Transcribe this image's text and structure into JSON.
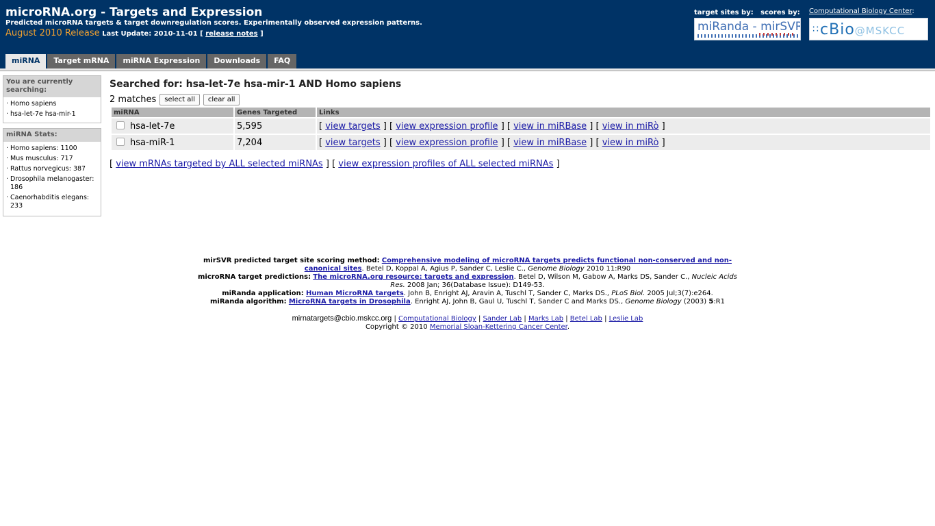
{
  "header": {
    "title": "microRNA.org - Targets and Expression",
    "tagline": "Predicted microRNA targets & target downregulation scores. Experimentally observed expression patterns.",
    "release": "August 2010 Release",
    "last_update_label": "Last Update:",
    "last_update": "2010-11-01",
    "release_notes_open": "[",
    "release_notes": "release notes",
    "release_notes_close": "]",
    "sites_label": "target sites by:   scores by:",
    "mirsvr_logo_text": "miRanda - mirSVR",
    "cbc_link": "Computational Biology Center",
    "cbc_colon": ":",
    "cbio_logo": {
      "dots": "∷",
      "main": "cBio",
      "suffix": "@MSKCC"
    }
  },
  "tabs": [
    {
      "label": "miRNA",
      "active": true
    },
    {
      "label": "Target mRNA",
      "active": false
    },
    {
      "label": "miRNA Expression",
      "active": false
    },
    {
      "label": "Downloads",
      "active": false
    },
    {
      "label": "FAQ",
      "active": false
    }
  ],
  "sidebar": {
    "searching_title": "You are currently searching:",
    "searching_items": [
      "Homo sapiens",
      "hsa-let-7e hsa-mir-1"
    ],
    "stats_title": "miRNA Stats:",
    "stats_items": [
      "Homo sapiens: 1100",
      "Mus musculus: 717",
      "Rattus norvegicus: 387",
      "Drosophila melanogaster: 186",
      "Caenorhabditis elegans: 233"
    ]
  },
  "main": {
    "search_heading": "Searched for: hsa-let-7e hsa-mir-1 AND Homo sapiens",
    "matches": "2 matches",
    "select_all": "select all",
    "clear_all": "clear all",
    "columns": [
      "miRNA",
      "Genes Targeted",
      "Links"
    ],
    "rows": [
      {
        "mirna": "hsa-let-7e",
        "genes": "5,595"
      },
      {
        "mirna": "hsa-miR-1",
        "genes": "7,204"
      }
    ],
    "row_links": {
      "open": "[",
      "close": "]",
      "sep": "] [",
      "view_targets": "view targets",
      "view_expression": "view expression profile",
      "view_mirbase": "view in miRBase",
      "view_miro": "view in miRò"
    },
    "all_open": "[",
    "all_sep": "] [",
    "all_close": "]",
    "view_all_targets": "view mRNAs targeted by ALL selected miRNAs",
    "view_all_expression": "view expression profiles of ALL selected miRNAs"
  },
  "citations": {
    "mirsvr": {
      "label": "mirSVR predicted target site scoring method:",
      "link": "Comprehensive modeling of microRNA targets predicts functional non-conserved and non-canonical sites",
      "authors": ". Betel D, Koppal A, Agius P, Sander C, Leslie C.,",
      "journal": "Genome Biology",
      "ref": "2010 11:R90"
    },
    "predictions": {
      "label": "microRNA target predictions:",
      "link": "The microRNA.org resource: targets and expression",
      "authors": ". Betel D, Wilson M, Gabow A, Marks DS, Sander C.,",
      "journal": "Nucleic Acids Res.",
      "ref": "2008 Jan; 36(Database Issue): D149-53."
    },
    "miranda_app": {
      "label": "miRanda application:",
      "link": "Human MicroRNA targets",
      "authors": ". John B, Enright AJ, Aravin A, Tuschl T, Sander C, Marks DS.,",
      "journal": "PLoS Biol.",
      "ref": "2005 Jul;3(7):e264."
    },
    "miranda_alg": {
      "label": "miRanda algorithm:",
      "link": "MicroRNA targets in Drosophila",
      "authors": ". Enright AJ, John B, Gaul U, Tuschl T, Sander C and Marks DS.,",
      "journal": "Genome Biology",
      "ref_pre": "(2003)",
      "ref_vol": "5",
      "ref_post": ":R1"
    }
  },
  "footer": {
    "email": "mirnatargets@cbio.mskcc.org",
    "sep": "|",
    "links": [
      "Computational Biology",
      "Sander Lab",
      "Marks Lab",
      "Betel Lab",
      "Leslie Lab"
    ],
    "copyright": "Copyright © 2010",
    "msk_link": "Memorial Sloan-Kettering Cancer Center",
    "period": "."
  }
}
